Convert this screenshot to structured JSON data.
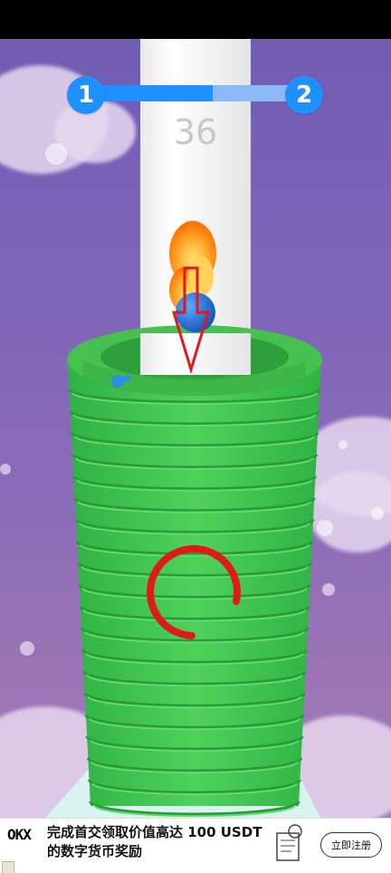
{
  "game": {
    "level_current": "1",
    "level_next": "2",
    "level_progress": 0.58,
    "score": "36"
  },
  "hints": {
    "arrow_color": "#dd1b1b",
    "circle_color": "#dd1b1b"
  },
  "colors": {
    "tower_green": "#3cc54f",
    "pole_white": "#f7f7f7",
    "ball_blue": "#1e6fe0",
    "progress_blue": "#1e90ff",
    "progress_track": "#8ab9f5"
  },
  "ad": {
    "logo": "OKX",
    "title_line1": "完成首交领取价值高达 100 USDT",
    "title_line2": "的数字货币奖励",
    "cta": "立即注册"
  },
  "icons": [
    "fire-icon",
    "ball-icon",
    "arrow-down-icon",
    "circle-hint-icon",
    "ad-close-icon"
  ]
}
